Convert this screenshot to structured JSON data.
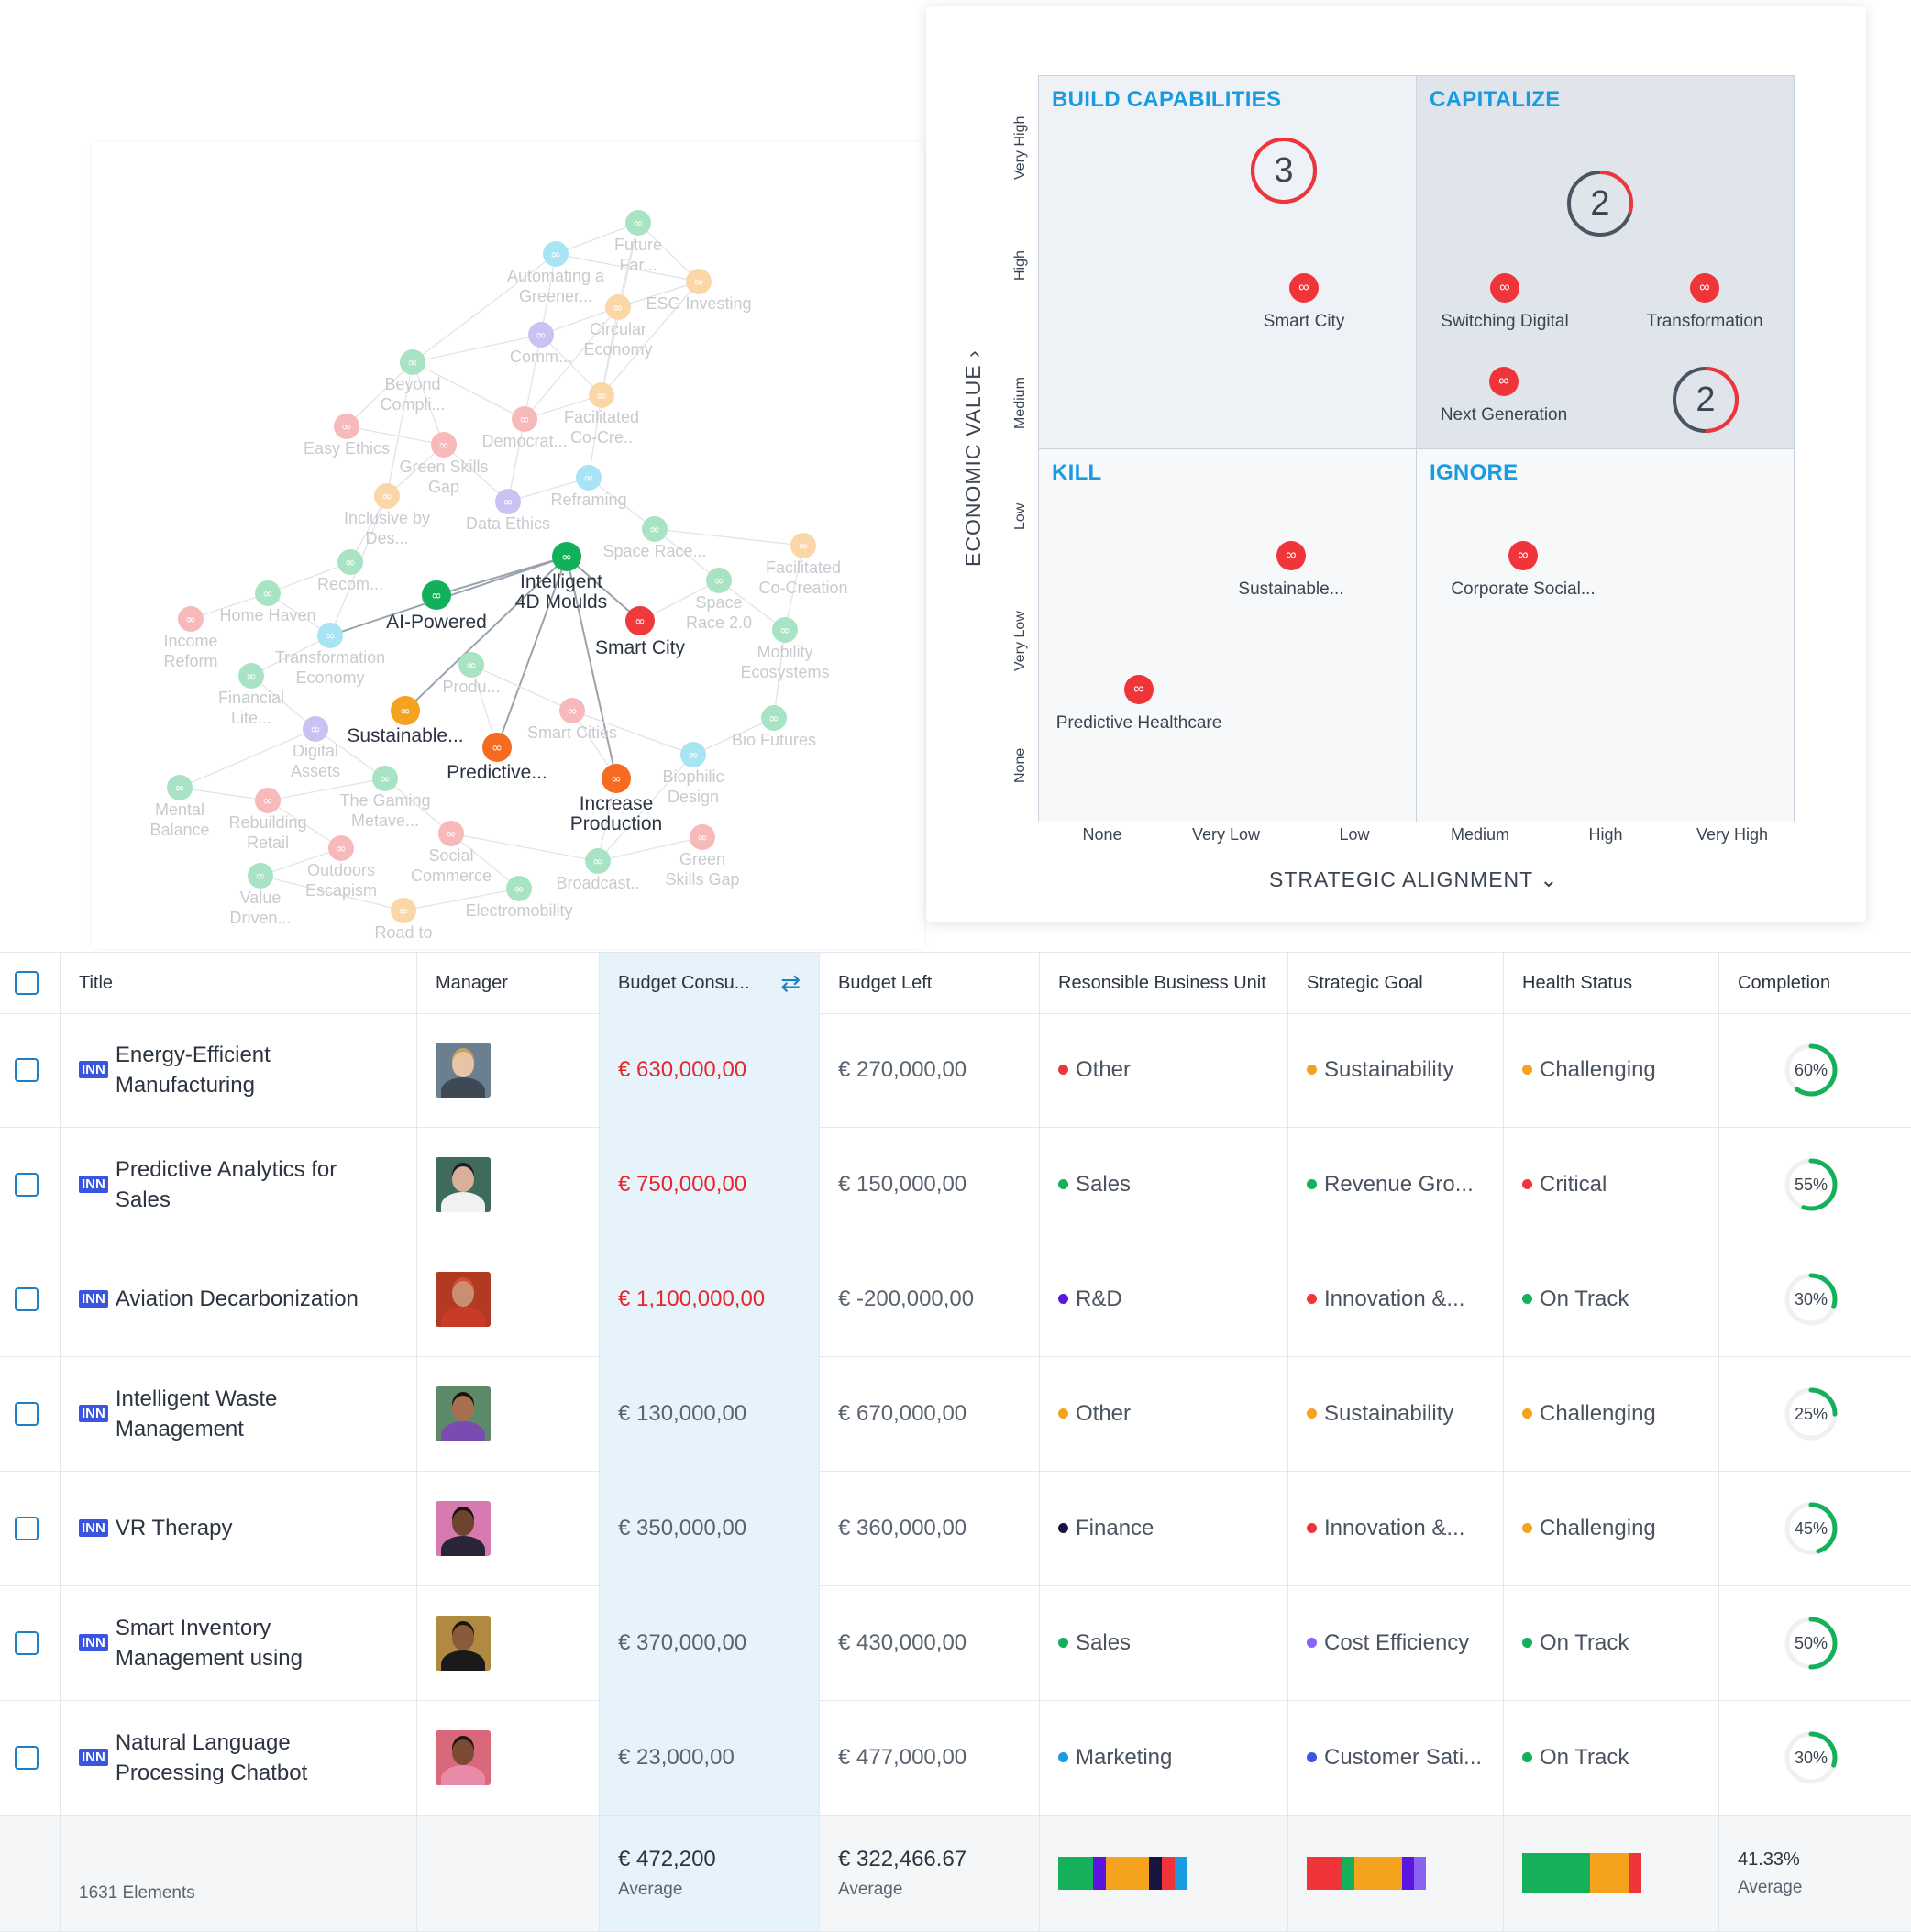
{
  "graph": {
    "nodes": [
      {
        "id": "n1",
        "label": [
          "Future",
          "Far..."
        ],
        "color": "#a8e3c4",
        "faded": true
      },
      {
        "id": "n2",
        "label": [
          "Automating a",
          "Greener..."
        ],
        "color": "#a9e4f5",
        "faded": true
      },
      {
        "id": "n3",
        "label": [
          "ESG Investing"
        ],
        "color": "#fbd7a8",
        "faded": true
      },
      {
        "id": "n4",
        "label": [
          "Circular",
          "Economy"
        ],
        "color": "#fbd7a8",
        "faded": true
      },
      {
        "id": "n5",
        "label": [
          "Comm..."
        ],
        "color": "#c9c2f3",
        "faded": true
      },
      {
        "id": "n6",
        "label": [
          "Beyond",
          "Compli..."
        ],
        "color": "#a8e3c4",
        "faded": true
      },
      {
        "id": "n7",
        "label": [
          "Facilitated",
          "Co-Cre.."
        ],
        "color": "#fbd7a8",
        "faded": true
      },
      {
        "id": "n8",
        "label": [
          "Easy Ethics"
        ],
        "color": "#f7b9b9",
        "faded": true
      },
      {
        "id": "n9",
        "label": [
          "Democrat..."
        ],
        "color": "#f7b9b9",
        "faded": true
      },
      {
        "id": "n10",
        "label": [
          "Green Skills",
          "Gap"
        ],
        "color": "#f7b9b9",
        "faded": true
      },
      {
        "id": "n11",
        "label": [
          "Reframing"
        ],
        "color": "#a9e4f5",
        "faded": true
      },
      {
        "id": "n12",
        "label": [
          "Inclusive by",
          "Des..."
        ],
        "color": "#fbd7a8",
        "faded": true
      },
      {
        "id": "n13",
        "label": [
          "Data Ethics"
        ],
        "color": "#c9c2f3",
        "faded": true
      },
      {
        "id": "n14",
        "label": [
          "Space Race..."
        ],
        "color": "#a8e3c4",
        "faded": true
      },
      {
        "id": "n15",
        "label": [
          "Facilitated",
          "Co-Creation"
        ],
        "color": "#fbd7a8",
        "faded": true
      },
      {
        "id": "n16",
        "label": [
          "Intelligent",
          "4D Moulds"
        ],
        "color": "#12b05a",
        "faded": false
      },
      {
        "id": "n17",
        "label": [
          "Recom..."
        ],
        "color": "#a8e3c4",
        "faded": true
      },
      {
        "id": "n18",
        "label": [
          "AI-Powered"
        ],
        "color": "#12b05a",
        "faded": false
      },
      {
        "id": "n19",
        "label": [
          "Space",
          "Race 2.0"
        ],
        "color": "#a8e3c4",
        "faded": true
      },
      {
        "id": "n20",
        "label": [
          "Home Haven"
        ],
        "color": "#a8e3c4",
        "faded": true
      },
      {
        "id": "n21",
        "label": [
          "Income",
          "Reform"
        ],
        "color": "#f7b9b9",
        "faded": true
      },
      {
        "id": "n22",
        "label": [
          "Smart City"
        ],
        "color": "#ee3a3a",
        "faded": false
      },
      {
        "id": "n23",
        "label": [
          "Mobility",
          "Ecosystems"
        ],
        "color": "#a8e3c4",
        "faded": true
      },
      {
        "id": "n24",
        "label": [
          "Transformation",
          "Economy"
        ],
        "color": "#a9e4f5",
        "faded": true
      },
      {
        "id": "n25",
        "label": [
          "Produ..."
        ],
        "color": "#a8e3c4",
        "faded": true
      },
      {
        "id": "n26",
        "label": [
          "Financial",
          "Lite..."
        ],
        "color": "#a8e3c4",
        "faded": true
      },
      {
        "id": "n27",
        "label": [
          "Sustainable..."
        ],
        "color": "#f5a21f",
        "faded": false
      },
      {
        "id": "n28",
        "label": [
          "Bio Futures"
        ],
        "color": "#a8e3c4",
        "faded": true
      },
      {
        "id": "n29",
        "label": [
          "Smart Cities"
        ],
        "color": "#f7b9b9",
        "faded": true
      },
      {
        "id": "n30",
        "label": [
          "Digital",
          "Assets"
        ],
        "color": "#c9c2f3",
        "faded": true
      },
      {
        "id": "n31",
        "label": [
          "Predictive..."
        ],
        "color": "#f56b1f",
        "faded": false
      },
      {
        "id": "n32",
        "label": [
          "Biophilic",
          "Design"
        ],
        "color": "#a9e4f5",
        "faded": true
      },
      {
        "id": "n33",
        "label": [
          "Increase",
          "Production"
        ],
        "color": "#f56b1f",
        "faded": false
      },
      {
        "id": "n34",
        "label": [
          "The Gaming",
          "Metave..."
        ],
        "color": "#a8e3c4",
        "faded": true
      },
      {
        "id": "n35",
        "label": [
          "Mental",
          "Balance"
        ],
        "color": "#a8e3c4",
        "faded": true
      },
      {
        "id": "n36",
        "label": [
          "Rebuilding",
          "Retail"
        ],
        "color": "#f7b9b9",
        "faded": true
      },
      {
        "id": "n37",
        "label": [
          "Social",
          "Commerce"
        ],
        "color": "#f7b9b9",
        "faded": true
      },
      {
        "id": "n38",
        "label": [
          "Green",
          "Skills Gap"
        ],
        "color": "#f7b9b9",
        "faded": true
      },
      {
        "id": "n39",
        "label": [
          "Outdoors",
          "Escapism"
        ],
        "color": "#f7b9b9",
        "faded": true
      },
      {
        "id": "n40",
        "label": [
          "Broadcast.."
        ],
        "color": "#a8e3c4",
        "faded": true
      },
      {
        "id": "n41",
        "label": [
          "Value",
          "Driven..."
        ],
        "color": "#a8e3c4",
        "faded": true
      },
      {
        "id": "n42",
        "label": [
          "Electromobility"
        ],
        "color": "#a8e3c4",
        "faded": true
      },
      {
        "id": "n43",
        "label": [
          "Road to"
        ],
        "color": "#fbd7a8",
        "faded": true
      }
    ]
  },
  "matrix": {
    "quadrants": {
      "build": "BUILD CAPABILITIES",
      "capitalize": "CAPITALIZE",
      "kill": "KILL",
      "ignore": "IGNORE"
    },
    "y_axis_title": "ECONOMIC VALUE",
    "x_axis_title": "STRATEGIC ALIGNMENT",
    "y_ticks": [
      "Very High",
      "High",
      "Medium",
      "Low",
      "Very Low",
      "None"
    ],
    "x_ticks": [
      "None",
      "Very Low",
      "Low",
      "Medium",
      "High",
      "Very High"
    ],
    "clusters": [
      {
        "count": "3",
        "ring_fill": 1.0,
        "x": "Low",
        "y": "Very High"
      },
      {
        "count": "2",
        "ring_fill": 0.3,
        "x": "High",
        "y": "Very High"
      },
      {
        "count": "2",
        "ring_fill": 0.5,
        "x": "Very High",
        "y": "Medium"
      }
    ],
    "items": [
      {
        "label": "Smart City",
        "x": "Low",
        "y": "High"
      },
      {
        "label": "Switching Digital",
        "x": "Medium",
        "y": "High"
      },
      {
        "label": "Transformation",
        "x": "Very High",
        "y": "High"
      },
      {
        "label": "Next Generation",
        "x": "Medium",
        "y": "Medium"
      },
      {
        "label": "Sustainable...",
        "x": "Low",
        "y": "Low"
      },
      {
        "label": "Corporate Social...",
        "x": "Medium",
        "y": "Low"
      },
      {
        "label": "Predictive Healthcare",
        "x": "Very Low",
        "y": "Very Low"
      }
    ]
  },
  "table": {
    "headers": {
      "title": "Title",
      "manager": "Manager",
      "budget_consumed": "Budget Consu...",
      "budget_left": "Budget Left",
      "business_unit": "Resonsible Business Unit",
      "strategic_goal": "Strategic Goal",
      "health": "Health Status",
      "completion": "Completion"
    },
    "badge": "INN",
    "rows": [
      {
        "title": "Energy-Efficient Manufacturing",
        "consumed": "€ 630,000,00",
        "over": true,
        "left": "€ 270,000,00",
        "unit": "Other",
        "unit_color": "#f0353a",
        "goal": "Sustainability",
        "goal_color": "#f5a21f",
        "health": "Challenging",
        "health_color": "#f5a21f",
        "completion": "60%",
        "completion_value": 0.6,
        "avatar": {
          "bg": "#6a7f90",
          "skin": "#e8c4a6",
          "shirt": "#3d4a55",
          "hair": "#c9a15e"
        }
      },
      {
        "title": "Predictive Analytics for Sales",
        "consumed": "€ 750,000,00",
        "over": true,
        "left": "€ 150,000,00",
        "unit": "Sales",
        "unit_color": "#14b05a",
        "goal": "Revenue Gro...",
        "goal_color": "#14b05a",
        "health": "Critical",
        "health_color": "#f0353a",
        "completion": "55%",
        "completion_value": 0.55,
        "avatar": {
          "bg": "#3f6b5c",
          "skin": "#d8b09a",
          "shirt": "#f1f1f1",
          "hair": "#1e1e1e"
        }
      },
      {
        "title": "Aviation Decarbonization",
        "consumed": "€ 1,100,000,00",
        "over": true,
        "left": "€ -200,000,00",
        "unit": "R&D",
        "unit_color": "#5a16e0",
        "goal": "Innovation &...",
        "goal_color": "#f0353a",
        "health": "On Track",
        "health_color": "#14b05a",
        "completion": "30%",
        "completion_value": 0.3,
        "avatar": {
          "bg": "#b13a22",
          "skin": "#c98f72",
          "shirt": "#c93a28",
          "hair": "#d94a30"
        }
      },
      {
        "title": "Intelligent Waste Management",
        "consumed": "€ 130,000,00",
        "over": false,
        "left": "€ 670,000,00",
        "unit": "Other",
        "unit_color": "#f5a21f",
        "goal": "Sustainability",
        "goal_color": "#f5a21f",
        "health": "Challenging",
        "health_color": "#f5a21f",
        "completion": "25%",
        "completion_value": 0.25,
        "avatar": {
          "bg": "#5e8a6a",
          "skin": "#a8704e",
          "shirt": "#7a4bb0",
          "hair": "#1a1410"
        }
      },
      {
        "title": "VR Therapy",
        "consumed": "€ 350,000,00",
        "over": false,
        "left": "€ 360,000,00",
        "unit": "Finance",
        "unit_color": "#15153f",
        "goal": "Innovation &...",
        "goal_color": "#f0353a",
        "health": "Challenging",
        "health_color": "#f5a21f",
        "completion": "45%",
        "completion_value": 0.45,
        "avatar": {
          "bg": "#d77ab0",
          "skin": "#6e4430",
          "shirt": "#2a2438",
          "hair": "#1a1410"
        }
      },
      {
        "title": "Smart Inventory Management using",
        "consumed": "€ 370,000,00",
        "over": false,
        "left": "€ 430,000,00",
        "unit": "Sales",
        "unit_color": "#14b05a",
        "goal": "Cost Efficiency",
        "goal_color": "#8a63f0",
        "health": "On Track",
        "health_color": "#14b05a",
        "completion": "50%",
        "completion_value": 0.5,
        "avatar": {
          "bg": "#b08a40",
          "skin": "#8a5a3a",
          "shirt": "#1a1a1a",
          "hair": "#1a1410"
        }
      },
      {
        "title": "Natural Language Processing Chatbot",
        "consumed": "€ 23,000,00",
        "over": false,
        "left": "€ 477,000,00",
        "unit": "Marketing",
        "unit_color": "#1a9be0",
        "goal": "Customer Sati...",
        "goal_color": "#3a56e0",
        "health": "On Track",
        "health_color": "#14b05a",
        "completion": "30%",
        "completion_value": 0.3,
        "avatar": {
          "bg": "#d8687a",
          "skin": "#7a4a32",
          "shirt": "#e88aa8",
          "hair": "#1a1410"
        }
      }
    ],
    "footer": {
      "elements": "1631 Elements",
      "consumed_avg": "€ 472,200",
      "consumed_sub": "Average",
      "left_avg": "€ 322,466.67",
      "left_sub": "Average",
      "completion_avg": "41.33%",
      "completion_sub": "Average",
      "unit_bar": [
        {
          "color": "#14b05a",
          "share": 0.27
        },
        {
          "color": "#5a16e0",
          "share": 0.1
        },
        {
          "color": "#f5a21f",
          "share": 0.34
        },
        {
          "color": "#15153f",
          "share": 0.1
        },
        {
          "color": "#f0353a",
          "share": 0.1
        },
        {
          "color": "#1a9be0",
          "share": 0.09
        }
      ],
      "goal_bar": [
        {
          "color": "#f0353a",
          "share": 0.3
        },
        {
          "color": "#14b05a",
          "share": 0.1
        },
        {
          "color": "#f5a21f",
          "share": 0.4
        },
        {
          "color": "#5a16e0",
          "share": 0.1
        },
        {
          "color": "#8a63f0",
          "share": 0.1
        }
      ],
      "health_bar": [
        {
          "color": "#14b05a",
          "share": 0.57
        },
        {
          "color": "#f5a21f",
          "share": 0.33
        },
        {
          "color": "#f0353a",
          "share": 0.1
        }
      ]
    }
  }
}
